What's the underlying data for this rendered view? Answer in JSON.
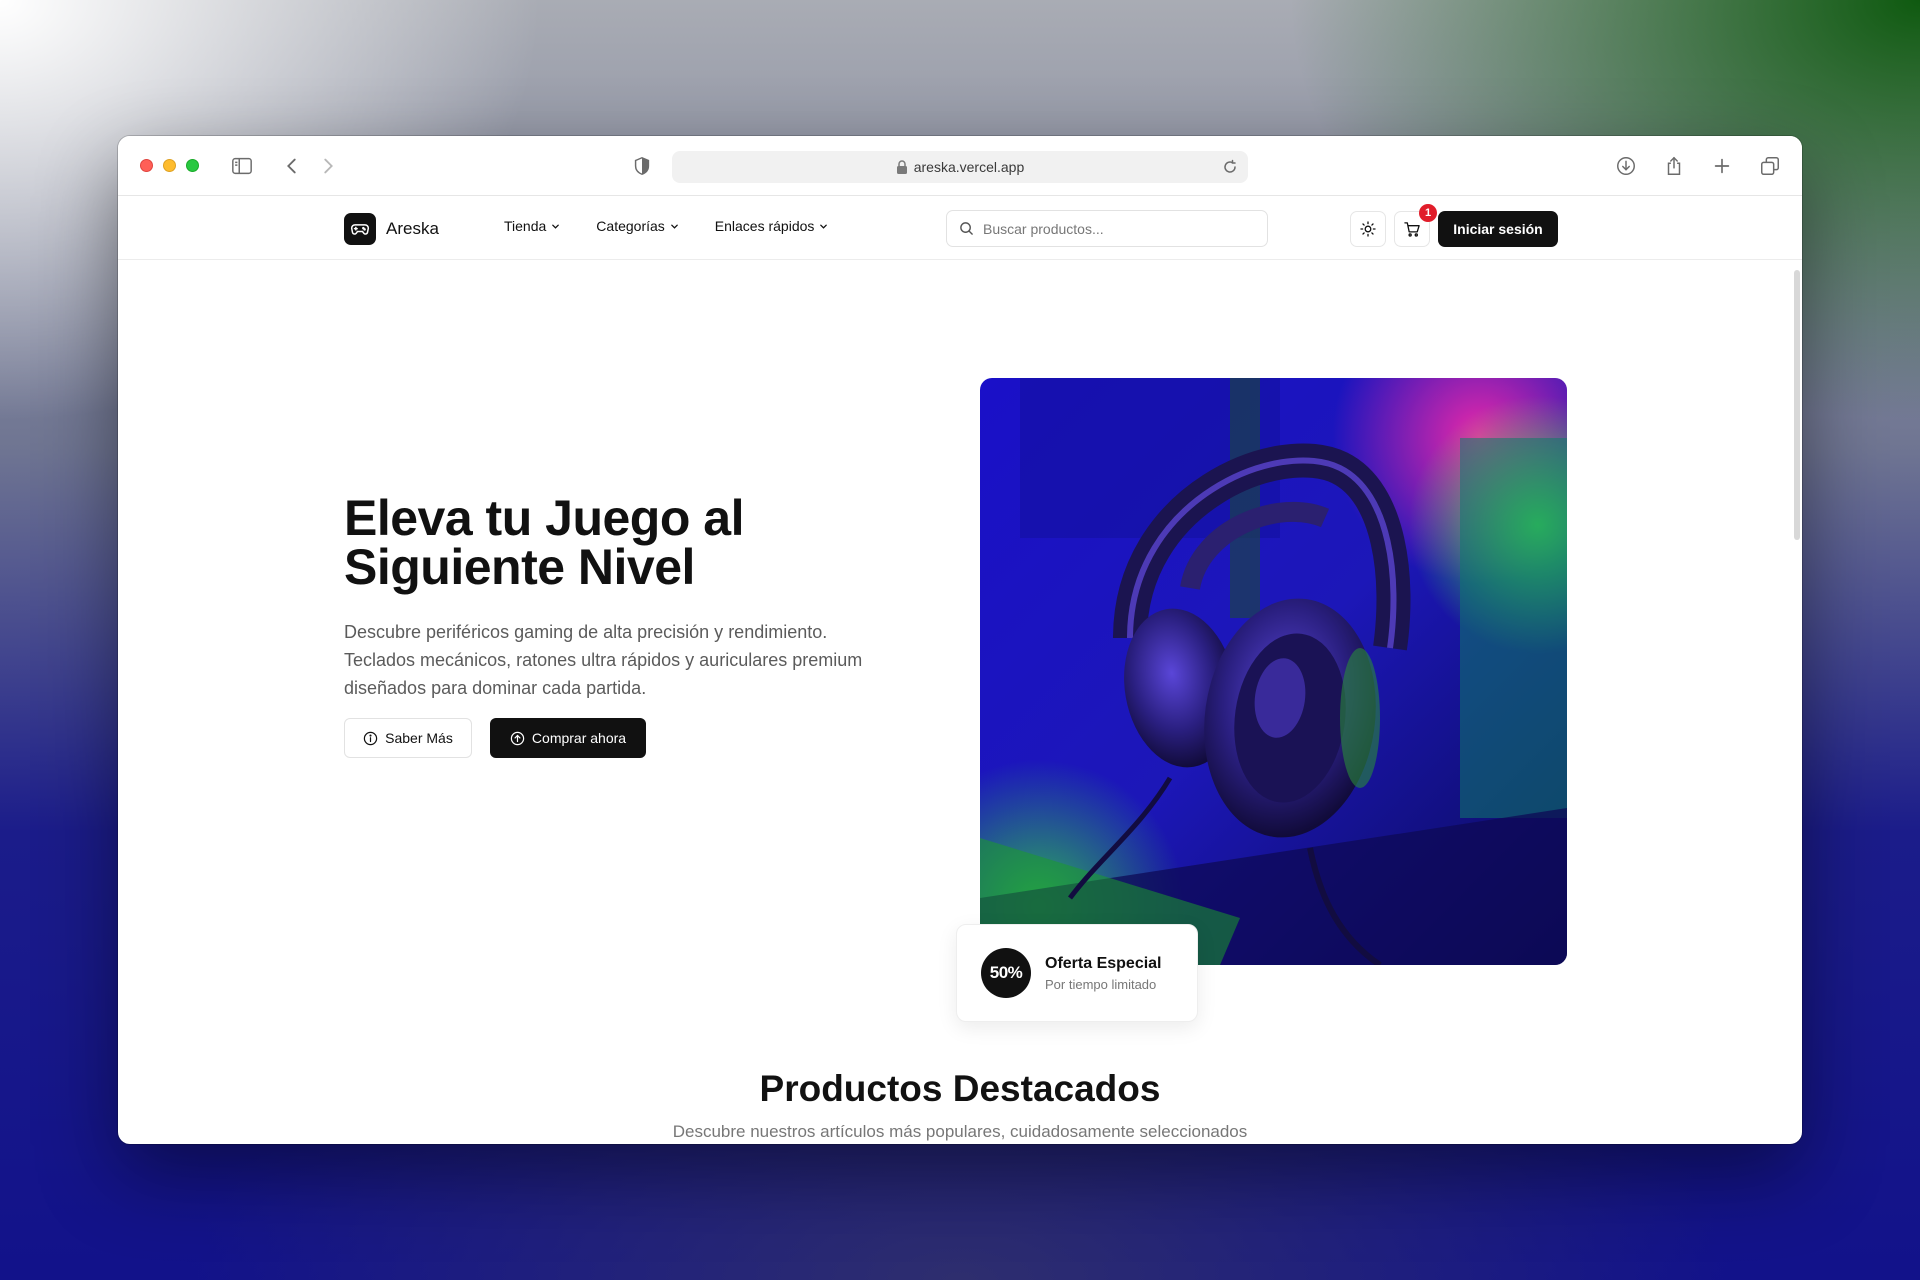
{
  "browser": {
    "url": "areska.vercel.app"
  },
  "site": {
    "brand": "Areska",
    "nav": [
      {
        "label": "Tienda"
      },
      {
        "label": "Categorías"
      },
      {
        "label": "Enlaces rápidos"
      }
    ],
    "search_placeholder": "Buscar productos...",
    "cart_count": "1",
    "login_label": "Iniciar sesión"
  },
  "hero": {
    "title_line1": "Eleva tu Juego al",
    "title_line2": "Siguiente Nivel",
    "description": "Descubre periféricos gaming de alta precisión y rendimiento. Teclados mecánicos, ratones ultra rápidos y auriculares premium diseñados para dominar cada partida.",
    "btn_secondary": "Saber Más",
    "btn_primary": "Comprar ahora"
  },
  "offer": {
    "badge": "50%",
    "title": "Oferta Especial",
    "subtitle": "Por tiempo limitado"
  },
  "featured": {
    "title": "Productos Destacados",
    "subtitle": "Descubre nuestros artículos más populares, cuidadosamente seleccionados"
  },
  "colors": {
    "primary": "#111111",
    "badge": "#e11d2a"
  }
}
